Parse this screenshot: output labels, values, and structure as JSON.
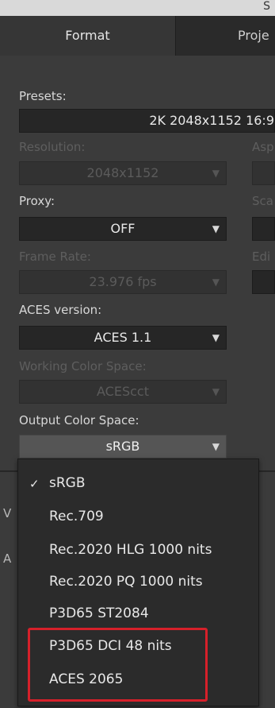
{
  "window": {
    "title_fragment": "S"
  },
  "tabs": [
    {
      "label": "Format",
      "active": true
    },
    {
      "label": "Proje",
      "active": false
    }
  ],
  "presets": {
    "label": "Presets:",
    "value": "2K 2048x1152 16:9"
  },
  "resolution": {
    "label": "Resolution:",
    "value": "2048x1152",
    "enabled": false
  },
  "aspect": {
    "label_fragment": "Asp"
  },
  "proxy": {
    "label": "Proxy:",
    "value": "OFF"
  },
  "scale": {
    "label_fragment": "Sca"
  },
  "frame_rate": {
    "label": "Frame Rate:",
    "value": "23.976 fps",
    "enabled": false
  },
  "edit": {
    "label_fragment": "Edi"
  },
  "aces_version": {
    "label": "ACES version:",
    "value": "ACES 1.1"
  },
  "working_color_space": {
    "label": "Working Color Space:",
    "value": "ACEScct",
    "enabled": false
  },
  "output_color_space": {
    "label": "Output Color Space:",
    "value": "sRGB"
  },
  "behind_labels": [
    "V",
    "A"
  ],
  "dropdown": {
    "selected": "sRGB",
    "check_glyph": "✓",
    "options": [
      "sRGB",
      "Rec.709",
      "Rec.2020 HLG 1000 nits",
      "Rec.2020 PQ  1000 nits",
      "P3D65 ST2084",
      "P3D65 DCI 48 nits",
      "ACES 2065"
    ],
    "highlighted": [
      "P3D65 DCI 48 nits",
      "ACES 2065"
    ]
  },
  "colors": {
    "panel": "#3b3b3b",
    "field": "#262626",
    "highlight_box": "#d6202a"
  }
}
